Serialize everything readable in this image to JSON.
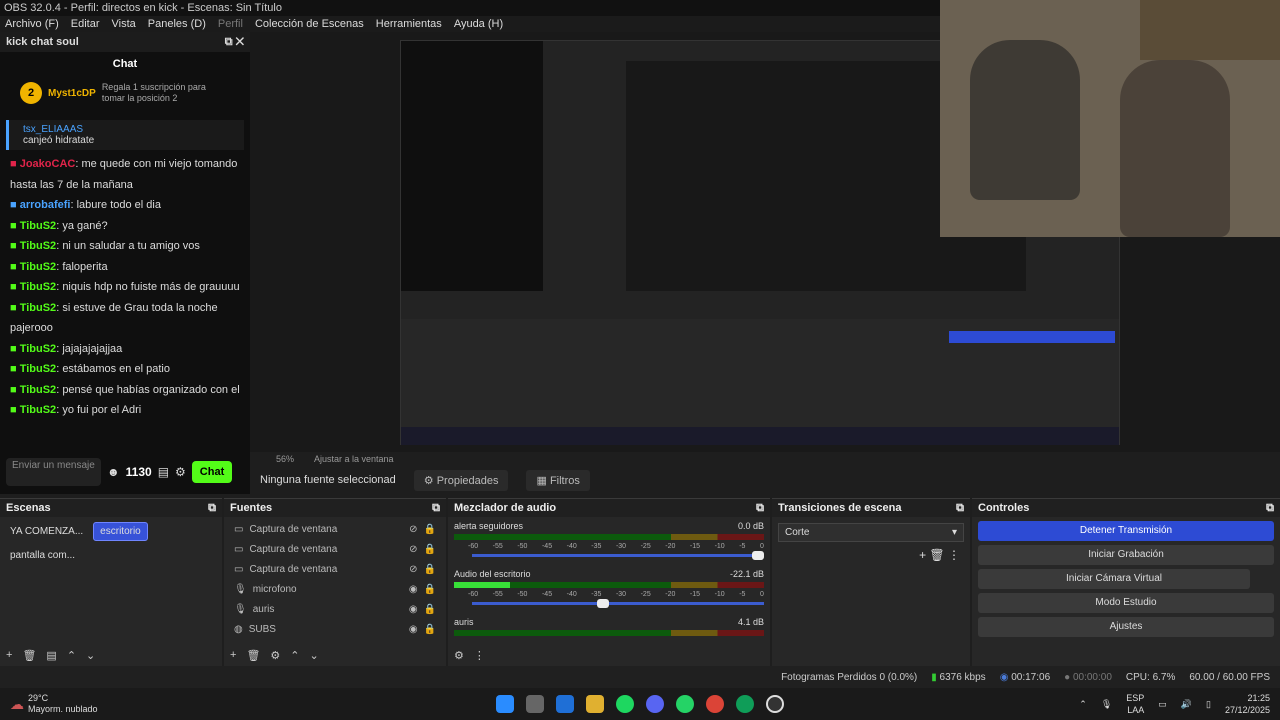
{
  "window": {
    "title": "OBS 32.0.4 - Perfil: directos en kick - Escenas: Sin Título"
  },
  "menu": [
    {
      "label": "Archivo (F)",
      "dim": false
    },
    {
      "label": "Editar",
      "dim": false
    },
    {
      "label": "Vista",
      "dim": false
    },
    {
      "label": "Paneles (D)",
      "dim": false
    },
    {
      "label": "Perfil",
      "dim": true
    },
    {
      "label": "Colección de Escenas",
      "dim": false
    },
    {
      "label": "Herramientas",
      "dim": false
    },
    {
      "label": "Ayuda (H)",
      "dim": false
    }
  ],
  "chat": {
    "dock_title": "kick chat soul",
    "title": "Chat",
    "top_user": "Myst1cDP",
    "top_rank": "2",
    "top_cta": "Regala 1 suscripción para tomar la posición 2",
    "redeem_user": "tsx_ELIAAAS",
    "redeem_text": "canjeó hidratate",
    "messages": [
      {
        "user": "JoakoCAC",
        "text": "me quede con mi viejo tomando hasta las 7 de la mañana",
        "color": "#e1244a"
      },
      {
        "user": "arrobafefi",
        "text": "labure todo el dia",
        "color": "#4aa3ff"
      },
      {
        "user": "TibuS2",
        "text": "ya gané?",
        "color": "#53fc18"
      },
      {
        "user": "TibuS2",
        "text": "ni un saludar a tu amigo vos",
        "color": "#53fc18"
      },
      {
        "user": "TibuS2",
        "text": "faloperita",
        "color": "#53fc18"
      },
      {
        "user": "TibuS2",
        "text": "niquis hdp no fuiste más de grauuuu",
        "color": "#53fc18"
      },
      {
        "user": "TibuS2",
        "text": "si estuve de Grau toda la noche pajerooo",
        "color": "#53fc18"
      },
      {
        "user": "TibuS2",
        "text": "jajajajajajjaa",
        "color": "#53fc18"
      },
      {
        "user": "TibuS2",
        "text": "estábamos en el patio",
        "color": "#53fc18"
      },
      {
        "user": "TibuS2",
        "text": "pensé que habías organizado con el",
        "color": "#53fc18"
      },
      {
        "user": "TibuS2",
        "text": "yo fui por el Adri",
        "color": "#53fc18"
      }
    ],
    "input_placeholder": "Enviar un mensaje",
    "points": "1130",
    "send_label": "Chat"
  },
  "preview": {
    "zoom": "56%",
    "fit": "Ajustar a la ventana",
    "no_source": "Ninguna fuente seleccionad",
    "properties": "Propiedades",
    "filters": "Filtros"
  },
  "scenes": {
    "title": "Escenas",
    "items": [
      {
        "label": "YA COMENZA...",
        "active": false
      },
      {
        "label": "escritorio",
        "active": true
      },
      {
        "label": "pantalla com...",
        "active": false
      }
    ]
  },
  "sources": {
    "title": "Fuentes",
    "items": [
      {
        "label": "Captura de ventana",
        "icon": "window-icon",
        "visible": false
      },
      {
        "label": "Captura de ventana",
        "icon": "window-icon",
        "visible": false
      },
      {
        "label": "Captura de ventana",
        "icon": "window-icon",
        "visible": false
      },
      {
        "label": "microfono",
        "icon": "mic-icon",
        "visible": true
      },
      {
        "label": "auris",
        "icon": "mic-icon",
        "visible": true
      },
      {
        "label": "SUBS",
        "icon": "globe-icon",
        "visible": true
      }
    ]
  },
  "mixer": {
    "title": "Mezclador de audio",
    "channels": [
      {
        "name": "alerta seguidores",
        "db": "0.0 dB",
        "level": 0.0,
        "fader": 1.0
      },
      {
        "name": "Audio del escritorio",
        "db": "-22.1 dB",
        "level": 0.18,
        "fader": 0.47
      },
      {
        "name": "auris",
        "db": "4.1 dB",
        "level": 0.0,
        "fader": 1.0
      }
    ],
    "scale": [
      "-60",
      "-55",
      "-50",
      "-45",
      "-40",
      "-35",
      "-30",
      "-25",
      "-20",
      "-15",
      "-10",
      "-5",
      "0"
    ]
  },
  "transitions": {
    "title": "Transiciones de escena",
    "selected": "Corte"
  },
  "controls": {
    "title": "Controles",
    "buttons": [
      {
        "label": "Detener Transmisión",
        "live": true
      },
      {
        "label": "Iniciar Grabación",
        "live": false
      },
      {
        "label": "Iniciar Cámara Virtual",
        "live": false
      },
      {
        "label": "Modo Estudio",
        "live": false
      },
      {
        "label": "Ajustes",
        "live": false
      }
    ]
  },
  "status": {
    "dropped": "Fotogramas Perdidos 0 (0.0%)",
    "bitrate": "6376 kbps",
    "stream_time": "00:17:06",
    "rec_time": "00:00:00",
    "cpu": "CPU: 6.7%",
    "fps": "60.00 / 60.00 FPS"
  },
  "taskbar": {
    "weather_temp": "29°C",
    "weather_desc": "Mayorm. nublado",
    "lang": "ESP",
    "layout": "LAA",
    "time": "21:25",
    "date": "27/12/2025"
  },
  "colors": {
    "accent": "#3752d8",
    "kick_green": "#53fc18"
  }
}
